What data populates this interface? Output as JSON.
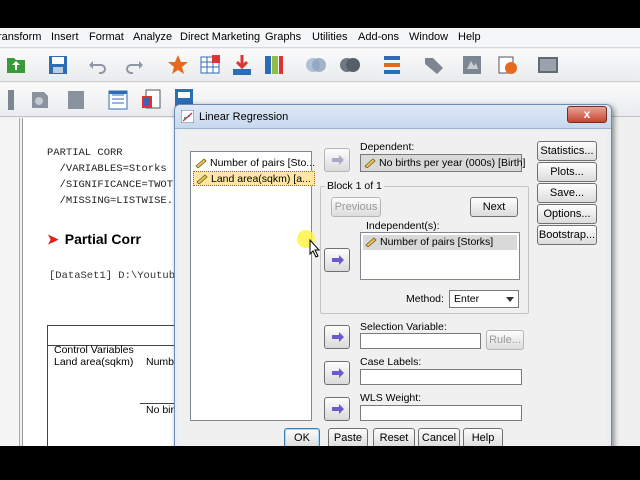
{
  "menu": [
    "ransform",
    "Insert",
    "Format",
    "Analyze",
    "Direct Marketing",
    "Graphs",
    "Utilities",
    "Add-ons",
    "Window",
    "Help"
  ],
  "menu_underline": [
    "",
    "I",
    "o",
    "n",
    "M",
    "G",
    "U",
    "d",
    "W",
    "H"
  ],
  "viewer": {
    "syntax_lines": [
      "PARTIAL CORR",
      "  /VARIABLES=Storks",
      "  /SIGNIFICANCE=TWOT",
      "  /MISSING=LISTWISE."
    ],
    "heading": "Partial Corr",
    "dataset": "[DataSet1] D:\\Youtub",
    "table": {
      "control_vars": "Control Variables",
      "row_label": "Land area(sqkm)",
      "col_header": "Numbe",
      "sub_label": "No birt"
    }
  },
  "dialog": {
    "title": "Linear Regression",
    "close_label": "x",
    "source_vars": [
      "Number of pairs [Sto...",
      "Land area(sqkm) [a..."
    ],
    "dependent": {
      "label": "Dependent:",
      "value": "No births per year (000s) [Birth]"
    },
    "block": {
      "caption": "Block 1 of 1",
      "previous": "Previous",
      "next": "Next"
    },
    "independents": {
      "label": "Independent(s):",
      "items": [
        "Number of pairs [Storks]"
      ]
    },
    "method": {
      "label": "Method:",
      "value": "Enter"
    },
    "selection_variable": {
      "label": "Selection Variable:",
      "value": "",
      "rule_button": "Rule..."
    },
    "case_labels": {
      "label": "Case Labels:",
      "value": ""
    },
    "wls_weight": {
      "label": "WLS Weight:",
      "value": ""
    },
    "side_buttons": [
      "Statistics...",
      "Plots...",
      "Save...",
      "Options...",
      "Bootstrap..."
    ],
    "bottom_buttons": [
      "OK",
      "Paste",
      "Reset",
      "Cancel",
      "Help"
    ]
  },
  "icons": {
    "toolbar1": [
      "open-icon",
      "save-icon",
      "undo-icon",
      "redo-icon",
      "goto-case-icon",
      "insert-cases-icon",
      "sort-icon",
      "split-file-icon",
      "variable-sets-icon",
      "weight-icon",
      "select-cases-icon",
      "value-labels-icon",
      "use-sets-icon",
      "show-all-icon",
      "spelling-icon",
      "script-icon"
    ],
    "toolbar2": [
      "print-preview-icon",
      "export-icon",
      "outline-icon",
      "insert-output-icon",
      "designate-window-icon"
    ]
  },
  "colors": {
    "accent_arrow": "#6a5acd",
    "heading_arrow": "#e0201b",
    "selected_item": "#ffe7a2"
  }
}
